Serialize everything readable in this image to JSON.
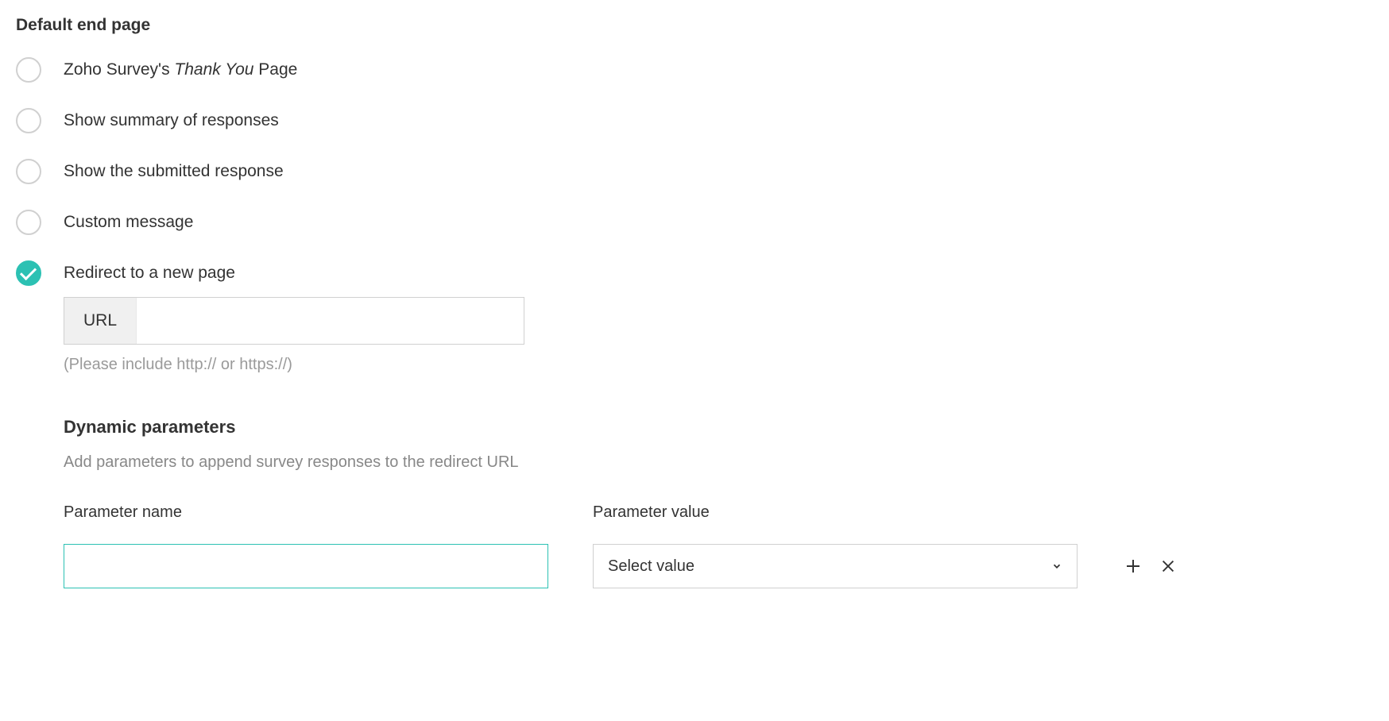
{
  "section_title": "Default end page",
  "options": {
    "thank_you": {
      "prefix": "Zoho Survey's ",
      "italic": "Thank You",
      "suffix": " Page",
      "selected": false
    },
    "summary": {
      "label": "Show summary of responses",
      "selected": false
    },
    "submitted": {
      "label": "Show the submitted response",
      "selected": false
    },
    "custom": {
      "label": "Custom message",
      "selected": false
    },
    "redirect": {
      "label": "Redirect to a new page",
      "selected": true
    }
  },
  "url": {
    "prefix_label": "URL",
    "value": "",
    "hint": "(Please include http:// or https://)"
  },
  "dynamic": {
    "title": "Dynamic parameters",
    "desc": "Add parameters to append survey responses to the redirect URL",
    "param_name_label": "Parameter name",
    "param_value_label": "Parameter value",
    "param_name_value": "",
    "select_placeholder": "Select value"
  }
}
